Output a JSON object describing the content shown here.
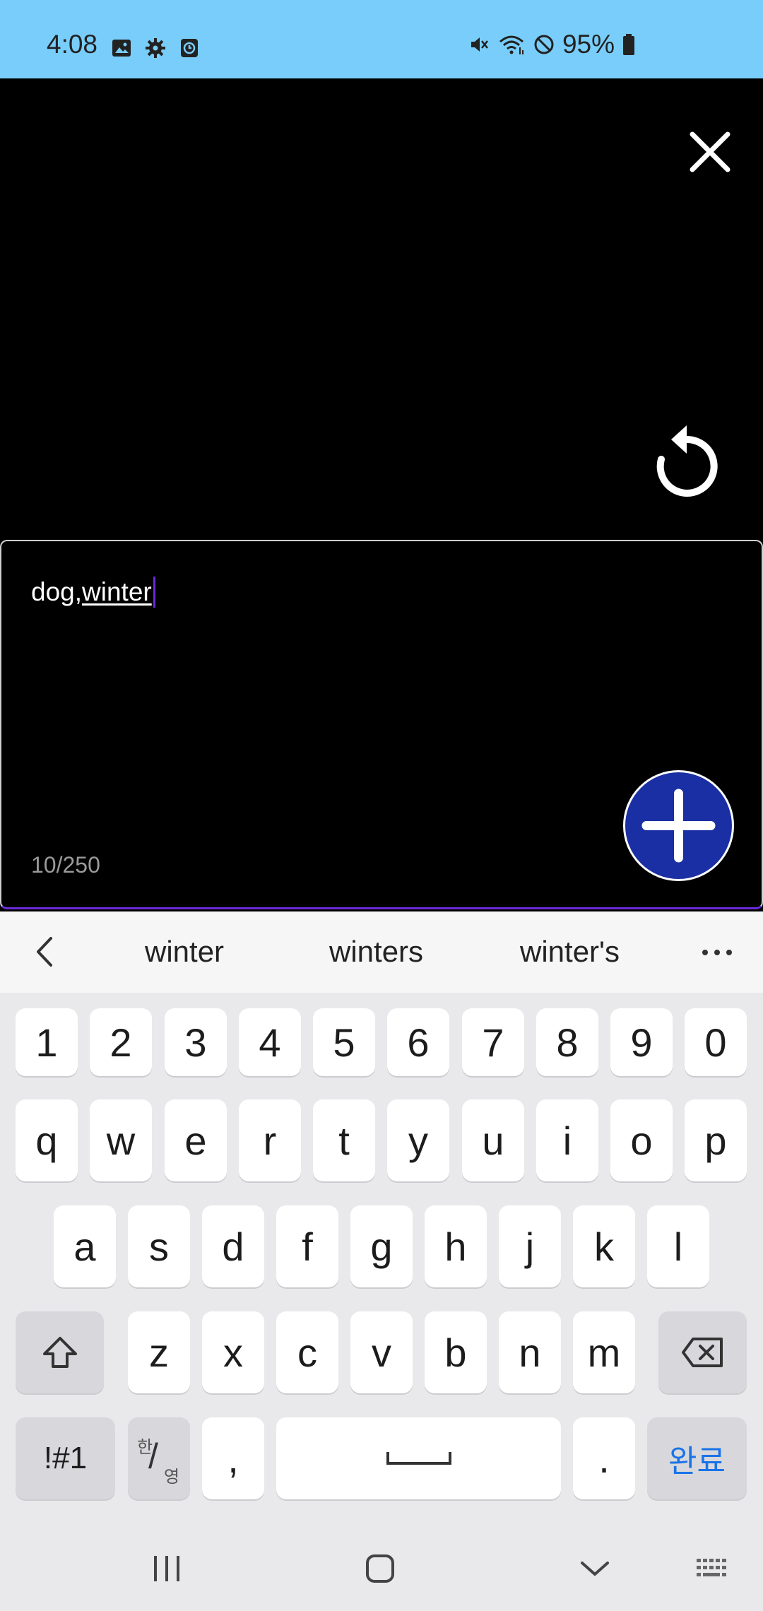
{
  "status_bar": {
    "time": "4:08",
    "battery_percent": "95%",
    "left_icons": [
      "gallery-icon",
      "gear-icon",
      "clock-app-icon"
    ],
    "right_icons": [
      "mute-icon",
      "wifi-icon",
      "do-not-disturb-icon",
      "battery-icon"
    ],
    "background_color": "#79cdfb"
  },
  "top_panel": {
    "close_icon": "close-icon",
    "reset_icon": "rotate-reset-icon"
  },
  "input": {
    "committed_text": "dog,",
    "composing_text": "winter",
    "counter": "10/250",
    "add_button_icon": "plus-icon",
    "add_button_color": "#1a2fa3"
  },
  "keyboard": {
    "suggestions": [
      "winter",
      "winters",
      "winter's"
    ],
    "number_row": [
      "1",
      "2",
      "3",
      "4",
      "5",
      "6",
      "7",
      "8",
      "9",
      "0"
    ],
    "row1": [
      "q",
      "w",
      "e",
      "r",
      "t",
      "y",
      "u",
      "i",
      "o",
      "p"
    ],
    "row2": [
      "a",
      "s",
      "d",
      "f",
      "g",
      "h",
      "j",
      "k",
      "l"
    ],
    "row3": [
      "z",
      "x",
      "c",
      "v",
      "b",
      "n",
      "m"
    ],
    "symbols_label": "!#1",
    "lang_top": "한",
    "lang_bottom": "영",
    "comma": ",",
    "period": ".",
    "done_label": "완료",
    "done_color": "#1a73e8"
  },
  "nav_bar": {
    "icons": [
      "recents-icon",
      "home-icon",
      "hide-keyboard-icon",
      "keyboard-switch-icon"
    ]
  }
}
